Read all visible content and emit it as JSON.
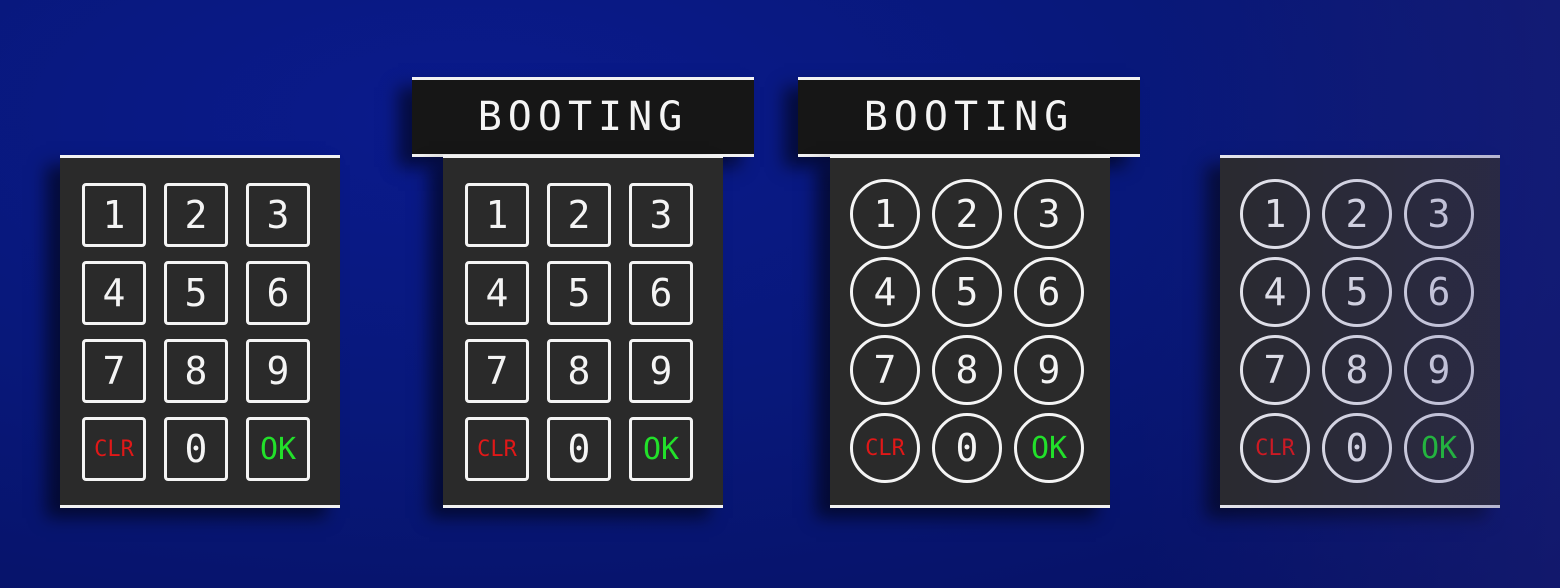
{
  "colors": {
    "background": "#08187a",
    "panel": "#2a2a2a",
    "banner": "#161616",
    "key_outline": "#f4f4f4",
    "clr_text": "#e01818",
    "ok_text": "#22e02a"
  },
  "banners": [
    "BOOTING",
    "BOOTING"
  ],
  "keypads": [
    {
      "style": "square",
      "keys": [
        "1",
        "2",
        "3",
        "4",
        "5",
        "6",
        "7",
        "8",
        "9",
        "CLR",
        "0",
        "OK"
      ]
    },
    {
      "style": "square",
      "keys": [
        "1",
        "2",
        "3",
        "4",
        "5",
        "6",
        "7",
        "8",
        "9",
        "CLR",
        "0",
        "OK"
      ]
    },
    {
      "style": "round",
      "keys": [
        "1",
        "2",
        "3",
        "4",
        "5",
        "6",
        "7",
        "8",
        "9",
        "CLR",
        "0",
        "OK"
      ]
    },
    {
      "style": "round",
      "keys": [
        "1",
        "2",
        "3",
        "4",
        "5",
        "6",
        "7",
        "8",
        "9",
        "CLR",
        "0",
        "OK"
      ]
    }
  ]
}
